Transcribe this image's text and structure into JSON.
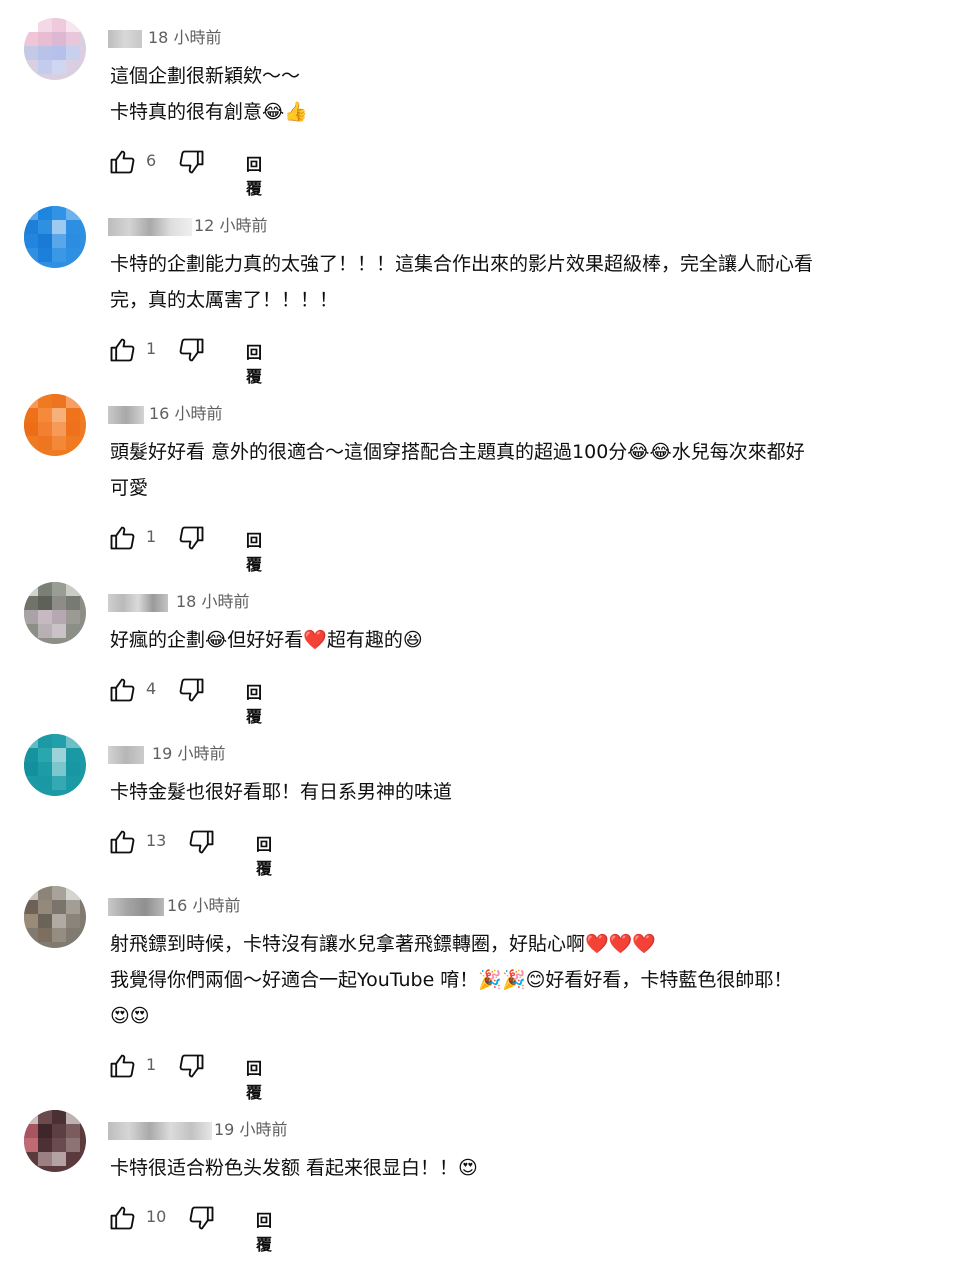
{
  "comments": [
    {
      "time": "18 小時前",
      "lines": [
        "這個企劃很新穎欸～～",
        "卡特真的很有創意😂👍"
      ],
      "likes": "6",
      "reply": "回覆"
    },
    {
      "time": "12 小時前",
      "lines": [
        "卡特的企劃能力真的太強了！！！這集合作出來的影片效果超級棒，完全讓人耐心看",
        "完，真的太厲害了！！！！"
      ],
      "likes": "1",
      "reply": "回覆"
    },
    {
      "time": "16 小時前",
      "lines": [
        "頭髮好好看 意外的很適合～這個穿搭配合主題真的超過100分😂😂水兒每次來都好",
        "可愛"
      ],
      "likes": "1",
      "reply": "回覆"
    },
    {
      "time": "18 小時前",
      "lines": [
        "好瘋的企劃😂但好好看❤️超有趣的😆"
      ],
      "likes": "4",
      "reply": "回覆"
    },
    {
      "time": "19 小時前",
      "lines": [
        "卡特金髮也很好看耶！有日系男神的味道"
      ],
      "likes": "13",
      "reply": "回覆"
    },
    {
      "time": "16 小時前",
      "lines": [
        "射飛鏢到時候，卡特沒有讓水兒拿著飛鏢轉圈，好貼心啊❤️❤️❤️",
        "我覺得你們兩個～好適合一起YouTube 唷！🎉🎉😊好看好看，卡特藍色很帥耶！",
        "😍😍"
      ],
      "likes": "1",
      "reply": "回覆"
    },
    {
      "time": "19 小時前",
      "lines": [
        "卡特很适合粉色头发额 看起来很显白！！😍"
      ],
      "likes": "10",
      "reply": "回覆"
    }
  ],
  "icons": {
    "like": "thumbs-up-icon",
    "dislike": "thumbs-down-icon"
  },
  "colors": {
    "text": "#0f0f0f",
    "meta": "#606060"
  }
}
